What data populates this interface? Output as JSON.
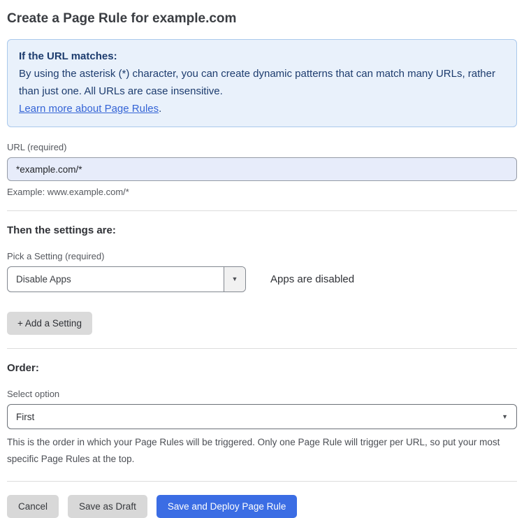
{
  "page": {
    "title": "Create a Page Rule for example.com"
  },
  "info_box": {
    "heading": "If the URL matches:",
    "body": "By using the asterisk (*) character, you can create dynamic patterns that can match many URLs, rather than just one. All URLs are case insensitive.",
    "link_label": "Learn more about Page Rules",
    "link_suffix": "."
  },
  "url_field": {
    "label": "URL (required)",
    "value": "*example.com/*",
    "hint": "Example: www.example.com/*"
  },
  "settings_section": {
    "heading": "Then the settings are:",
    "picker_label": "Pick a Setting (required)",
    "selected_setting": "Disable Apps",
    "setting_status": "Apps are disabled",
    "add_setting_label": "+ Add a Setting"
  },
  "order_section": {
    "heading": "Order:",
    "select_label": "Select option",
    "selected_option": "First",
    "description": "This is the order in which your Page Rules will be triggered. Only one Page Rule will trigger per URL, so put your most specific Page Rules at the top."
  },
  "actions": {
    "cancel_label": "Cancel",
    "save_draft_label": "Save as Draft",
    "save_deploy_label": "Save and Deploy Page Rule"
  },
  "icons": {
    "dropdown_arrow": "▼"
  },
  "colors": {
    "info_bg": "#e9f1fb",
    "info_border": "#a9c8ec",
    "info_text": "#1d3c6e",
    "link": "#3464d6",
    "input_bg": "#e7ecfa",
    "primary_button": "#3b6de4",
    "gray_button": "#d8d8d8"
  }
}
